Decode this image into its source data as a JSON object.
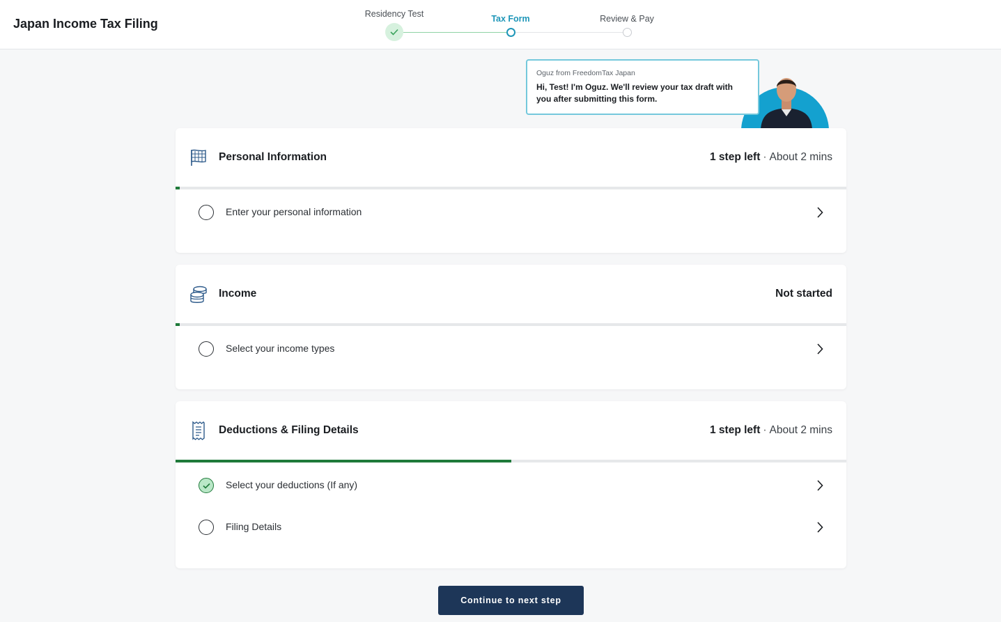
{
  "app": {
    "title": "Japan Income Tax Filing"
  },
  "stepper": {
    "steps": [
      {
        "label": "Residency Test",
        "state": "done"
      },
      {
        "label": "Tax Form",
        "state": "current"
      },
      {
        "label": "Review & Pay",
        "state": "future"
      }
    ]
  },
  "advisor": {
    "from": "Oguz from FreedomTax Japan",
    "message": "Hi, Test! I'm Oguz. We'll review your tax draft with you after submitting this form."
  },
  "sections": [
    {
      "title": "Personal Information",
      "icon": "building-flag-icon",
      "status_bold": "1 step left",
      "status_sep": "·",
      "status_time": "About 2 mins",
      "progress": 0.006,
      "tasks": [
        {
          "label": "Enter your personal information",
          "done": false
        }
      ]
    },
    {
      "title": "Income",
      "icon": "coins-stack-icon",
      "status_bold": "Not started",
      "status_sep": "",
      "status_time": "",
      "progress": 0.006,
      "tasks": [
        {
          "label": "Select your income types",
          "done": false
        }
      ]
    },
    {
      "title": "Deductions & Filing Details",
      "icon": "receipt-icon",
      "status_bold": "1 step left",
      "status_sep": "·",
      "status_time": "About 2 mins",
      "progress": 0.5,
      "tasks": [
        {
          "label": "Select your deductions (If any)",
          "done": true
        },
        {
          "label": "Filing Details",
          "done": false
        }
      ]
    }
  ],
  "actions": {
    "continue_label": "Continue to next step"
  },
  "colors": {
    "accent": "#1e96b8",
    "progress": "#1f7a3a",
    "button": "#1d3658",
    "advisor_bg": "#14a1cf",
    "done_fill": "#b9e7c7"
  }
}
